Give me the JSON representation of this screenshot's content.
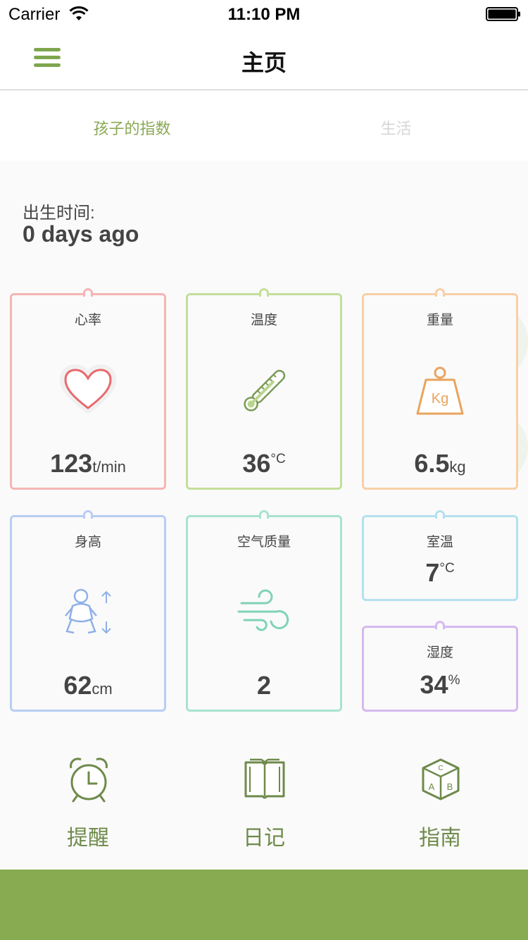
{
  "status_bar": {
    "carrier": "Carrier",
    "time": "11:10 PM"
  },
  "nav": {
    "title": "主页",
    "menu_icon": "hamburger-icon"
  },
  "tabs": [
    {
      "label": "孩子的指数",
      "active": true
    },
    {
      "label": "生活",
      "active": false
    }
  ],
  "birth": {
    "label": "出生时间:",
    "value": "0 days ago"
  },
  "cards": {
    "heart_rate": {
      "title": "心率",
      "value": "123",
      "unit": "t/min",
      "icon": "heart-icon",
      "color": "#f5b5b3"
    },
    "temperature": {
      "title": "温度",
      "value": "36",
      "unit": "°C",
      "icon": "thermometer-icon",
      "color": "#c3df9b"
    },
    "weight": {
      "title": "重量",
      "value": "6.5",
      "unit": "kg",
      "icon": "weight-kg-icon",
      "color": "#f8cfa8"
    },
    "height": {
      "title": "身高",
      "value": "62",
      "unit": "cm",
      "icon": "baby-height-icon",
      "color": "#b8cdf3"
    },
    "air_quality": {
      "title": "空气质量",
      "value": "2",
      "icon": "wind-icon",
      "color": "#a9e3d0"
    },
    "room_temp": {
      "title": "室温",
      "value": "7",
      "unit": "°C",
      "color": "#b3e1ee"
    },
    "humidity": {
      "title": "湿度",
      "value": "34",
      "unit": "%",
      "color": "#d5b9ef"
    }
  },
  "shortcuts": [
    {
      "label": "提醒",
      "icon": "alarm-clock-icon"
    },
    {
      "label": "日记",
      "icon": "book-icon"
    },
    {
      "label": "指南",
      "icon": "abc-block-icon"
    }
  ],
  "colors": {
    "accent": "#88ab52",
    "accent_text": "#6e8a4b"
  }
}
